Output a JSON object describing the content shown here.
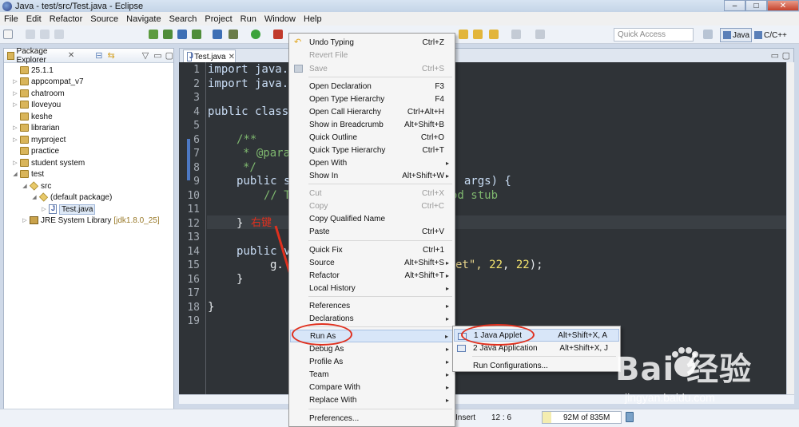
{
  "window": {
    "title": "Java - test/src/Test.java - Eclipse",
    "controls": [
      "–",
      "□",
      "✕"
    ]
  },
  "menubar": [
    "File",
    "Edit",
    "Refactor",
    "Source",
    "Navigate",
    "Search",
    "Project",
    "Run",
    "Window",
    "Help"
  ],
  "toolbar": {
    "quick_access_placeholder": "Quick Access",
    "perspective_java": "Java",
    "perspective_cpp": "C/C++"
  },
  "package_explorer": {
    "tab_label": "Package Explorer",
    "items": [
      {
        "label": "25.1.1",
        "expanded": false
      },
      {
        "label": "appcompat_v7",
        "expanded": false
      },
      {
        "label": "chatroom",
        "expanded": false
      },
      {
        "label": "Iloveyou",
        "expanded": false
      },
      {
        "label": "keshe",
        "expanded": false
      },
      {
        "label": "librarian",
        "expanded": false
      },
      {
        "label": "myproject",
        "expanded": false
      },
      {
        "label": "practice",
        "expanded": false
      },
      {
        "label": "student system",
        "expanded": false
      },
      {
        "label": "test",
        "expanded": true
      },
      {
        "label": "src",
        "expanded": true
      },
      {
        "label": "(default package)",
        "expanded": true
      },
      {
        "label": "Test.java",
        "expanded": false
      },
      {
        "label": "JRE System Library",
        "expanded": false,
        "suffix": "[jdk1.8.0_25]"
      }
    ]
  },
  "editor": {
    "tab_label": "Test.java",
    "line_numbers": [
      "1",
      "2",
      "3",
      "4",
      "5",
      "6",
      "7",
      "8",
      "9",
      "10",
      "11",
      "12",
      "13",
      "14",
      "15",
      "16",
      "17",
      "18",
      "19"
    ],
    "lines": {
      "l1": "import java.",
      "l2": "import java.",
      "l4": "public class",
      "l6": "/**",
      "l7": "* @para",
      "l8": "*/",
      "l9a": "public s",
      "l9b": "] args) {",
      "l10a": "// T",
      "l10b": "od stub",
      "l12": "}",
      "l14": "public v",
      "l15a": "g.",
      "l15b": "et\", ",
      "l15c": "22",
      "l15d": ", ",
      "l15e": "22",
      "l15f": ");",
      "l16": "}",
      "l18": "}"
    }
  },
  "annotation": {
    "label": "右键"
  },
  "context_menu": {
    "items": [
      {
        "label": "Undo Typing",
        "shortcut": "Ctrl+Z"
      },
      {
        "label": "Revert File",
        "shortcut": ""
      },
      {
        "label": "Save",
        "shortcut": "Ctrl+S"
      },
      {
        "label": "Open Declaration",
        "shortcut": "F3"
      },
      {
        "label": "Open Type Hierarchy",
        "shortcut": "F4"
      },
      {
        "label": "Open Call Hierarchy",
        "shortcut": "Ctrl+Alt+H"
      },
      {
        "label": "Show in Breadcrumb",
        "shortcut": "Alt+Shift+B"
      },
      {
        "label": "Quick Outline",
        "shortcut": "Ctrl+O"
      },
      {
        "label": "Quick Type Hierarchy",
        "shortcut": "Ctrl+T"
      },
      {
        "label": "Open With",
        "shortcut": ""
      },
      {
        "label": "Show In",
        "shortcut": "Alt+Shift+W"
      },
      {
        "label": "Cut",
        "shortcut": "Ctrl+X"
      },
      {
        "label": "Copy",
        "shortcut": "Ctrl+C"
      },
      {
        "label": "Copy Qualified Name",
        "shortcut": ""
      },
      {
        "label": "Paste",
        "shortcut": "Ctrl+V"
      },
      {
        "label": "Quick Fix",
        "shortcut": "Ctrl+1"
      },
      {
        "label": "Source",
        "shortcut": "Alt+Shift+S"
      },
      {
        "label": "Refactor",
        "shortcut": "Alt+Shift+T"
      },
      {
        "label": "Local History",
        "shortcut": ""
      },
      {
        "label": "References",
        "shortcut": ""
      },
      {
        "label": "Declarations",
        "shortcut": ""
      },
      {
        "label": "Run As",
        "shortcut": ""
      },
      {
        "label": "Debug As",
        "shortcut": ""
      },
      {
        "label": "Profile As",
        "shortcut": ""
      },
      {
        "label": "Team",
        "shortcut": ""
      },
      {
        "label": "Compare With",
        "shortcut": ""
      },
      {
        "label": "Replace With",
        "shortcut": ""
      },
      {
        "label": "Preferences...",
        "shortcut": ""
      }
    ],
    "submenu_arrow": "▸"
  },
  "run_as_submenu": {
    "items": [
      {
        "label": "1 Java Applet",
        "shortcut": "Alt+Shift+X, A"
      },
      {
        "label": "2 Java Application",
        "shortcut": "Alt+Shift+X, J"
      },
      {
        "label": "Run Configurations...",
        "shortcut": ""
      }
    ]
  },
  "status_bar": {
    "insert_mode": "Insert",
    "cursor_position": "12 : 6",
    "heap": "92M of 835M",
    "heap_used_fraction": 0.11
  },
  "watermark": {
    "brand": "Bai 经验",
    "url": "jingyan.baidu.com"
  },
  "colors": {
    "editor_bg": "#2f3337",
    "annotation_red": "#e0301e",
    "menu_bg": "#f5f5f5",
    "highlight": "#d8e6f8"
  }
}
